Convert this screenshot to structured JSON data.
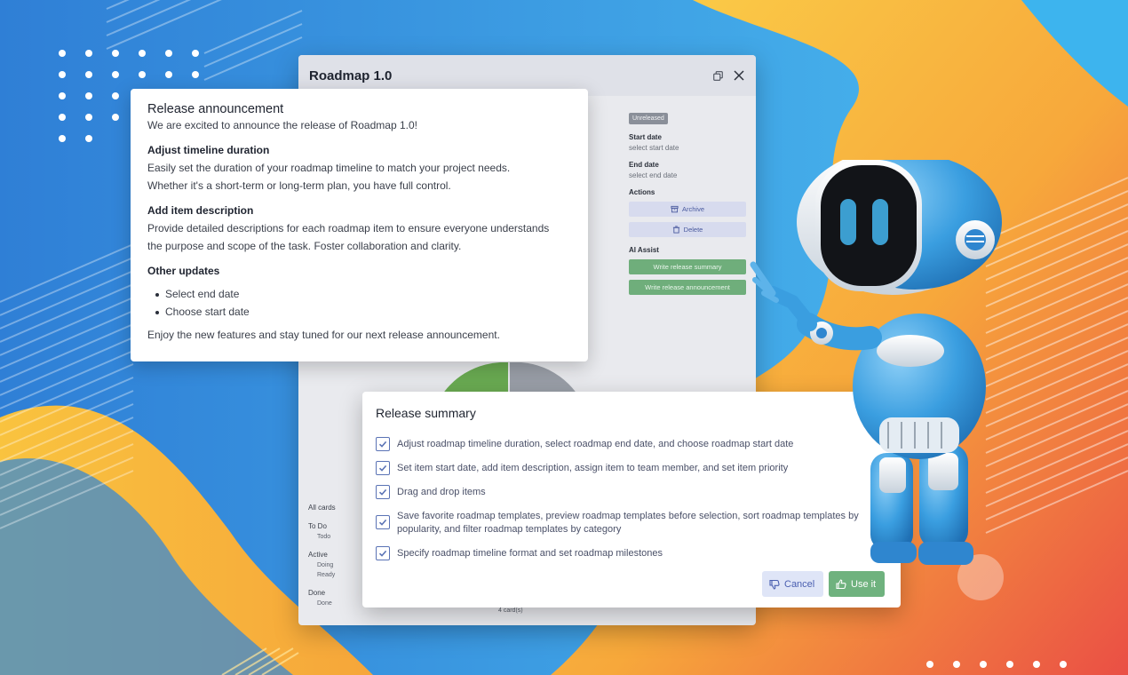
{
  "window": {
    "title": "Roadmap 1.0",
    "status_badge": "Unreleased",
    "start_date_label": "Start date",
    "start_date_value": "select start date",
    "end_date_label": "End date",
    "end_date_value": "select end date",
    "actions_label": "Actions",
    "archive_label": "Archive",
    "delete_label": "Delete",
    "ai_assist_label": "AI Assist",
    "write_summary_label": "Write release summary",
    "write_announcement_label": "Write release announcement",
    "cards": {
      "all_label": "All cards",
      "todo_label": "To Do",
      "todo_items": [
        "Todo"
      ],
      "active_label": "Active",
      "active_items": [
        "Doing",
        "Ready"
      ],
      "done_label": "Done",
      "done_items": [
        "Done"
      ],
      "count_text": "4 card(s)"
    }
  },
  "announcement": {
    "title": "Release announcement",
    "intro": "We are excited to announce the release of Roadmap 1.0!",
    "section1_heading": "Adjust timeline duration",
    "section1_line1": "Easily set the duration of your roadmap timeline to match your project needs.",
    "section1_line2": "Whether it's a short-term or long-term plan, you have full control.",
    "section2_heading": "Add item description",
    "section2_line1": "Provide detailed descriptions for each roadmap item to ensure everyone understands",
    "section2_line2": "the purpose and scope of the task. Foster collaboration and clarity.",
    "section3_heading": "Other updates",
    "updates": [
      "Select end date",
      "Choose start date"
    ],
    "footer": "Enjoy the new features and stay tuned for our next release announcement."
  },
  "summary": {
    "title": "Release summary",
    "items": [
      "Adjust roadmap timeline duration, select roadmap end date, and choose roadmap start date",
      "Set item start date, add item description, assign item to team member, and set item priority",
      "Drag and drop items",
      "Save favorite roadmap templates, preview roadmap templates before selection, sort roadmap templates by popularity, and filter roadmap templates by category",
      "Specify roadmap timeline format and set roadmap milestones"
    ],
    "cancel_label": "Cancel",
    "use_label": "Use it"
  },
  "colors": {
    "accent_green": "#6fb27e",
    "accent_blue": "#4a5fb0",
    "bg_blue": "#3aa0e6",
    "bg_orange": "#f29a3b",
    "bg_red": "#e84a4a"
  }
}
